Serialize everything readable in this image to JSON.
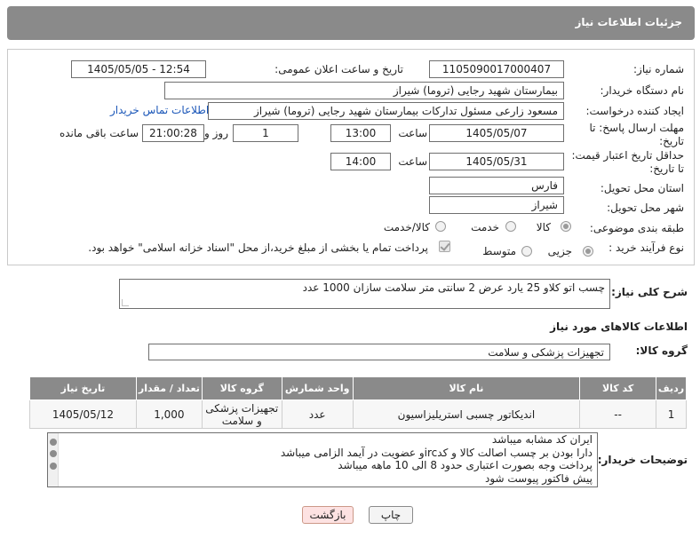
{
  "header": {
    "title": "جزئیات اطلاعات نیاز"
  },
  "form": {
    "need_number_label": "شماره نیاز:",
    "need_number": "1105090017000407",
    "announce_label": "تاریخ و ساعت اعلان عمومی:",
    "announce_value": "1405/05/05 - 12:54",
    "buyer_org_label": "نام دستگاه خریدار:",
    "buyer_org": "بیمارستان شهید رجایی (تروما) شیراز",
    "creator_label": "ایجاد کننده درخواست:",
    "creator": "مسعود زارعی مسئول تدارکات بیمارستان شهید رجایی (تروما) شیراز",
    "contact_link": "اطلاعات تماس خریدار",
    "reply_deadline_label_1": "مهلت ارسال پاسخ: تا",
    "reply_deadline_label_2": "تاریخ:",
    "reply_date": "1405/05/07",
    "time_label": "ساعت",
    "reply_time": "13:00",
    "days_value": "1",
    "days_label": "روز و",
    "remaining_time": "21:00:28",
    "remaining_label": "ساعت باقی مانده",
    "price_validity_label_1": "حداقل تاریخ اعتبار قیمت:",
    "price_validity_label_2": "تا تاریخ:",
    "price_date": "1405/05/31",
    "price_time": "14:00",
    "province_label": "استان محل تحویل:",
    "province": "فارس",
    "city_label": "شهر محل تحویل:",
    "city": "شیراز",
    "category_label": "طبقه بندی موضوعی:",
    "category_options": [
      "کالا",
      "خدمت",
      "کالا/خدمت"
    ],
    "category_selected": "کالا",
    "process_label": "نوع فرآیند خرید :",
    "process_options": [
      "جزیی",
      "متوسط"
    ],
    "process_selected": "جزیی",
    "payment_note": "پرداخت تمام یا بخشی از مبلغ خرید،از محل \"اسناد خزانه اسلامی\" خواهد بود."
  },
  "description": {
    "label": "شرح کلی نیاز:",
    "text": "چسب اتو کلاو 25 یارد  عرض 2 سانتی متر سلامت سازان 1000 عدد"
  },
  "goods_info": {
    "title": "اطلاعات کالاهای مورد نیاز",
    "group_label": "گروه کالا:",
    "group_value": "تجهیزات پزشکی و سلامت"
  },
  "table": {
    "headers": [
      "ردیف",
      "کد کالا",
      "نام کالا",
      "واحد شمارش",
      "گروه کالا",
      "تعداد / مقدار",
      "تاریخ نیاز"
    ],
    "rows": [
      [
        "1",
        "--",
        "اندیکاتور چسبی استریلیزاسیون",
        "عدد",
        "تجهیزات پزشکی و سلامت",
        "1,000",
        "1405/05/12"
      ]
    ]
  },
  "notes": {
    "label": "توضیحات خریدار:",
    "lines": [
      "ایران کد مشابه میباشد",
      "دارا بودن بر چسب اصالت کالا و کدircو عضویت در آیمد الزامی میباشد",
      "پرداخت وجه بصورت اعتباری حدود 8 الی 10 ماهه میباشد",
      "پیش فاکتور پیوست شود"
    ]
  },
  "buttons": {
    "print": "چاپ",
    "back": "بازگشت"
  },
  "colors": {
    "header_bg": "#8a8a8a",
    "link": "#1a56b8",
    "back_bg": "#fde2e2"
  }
}
